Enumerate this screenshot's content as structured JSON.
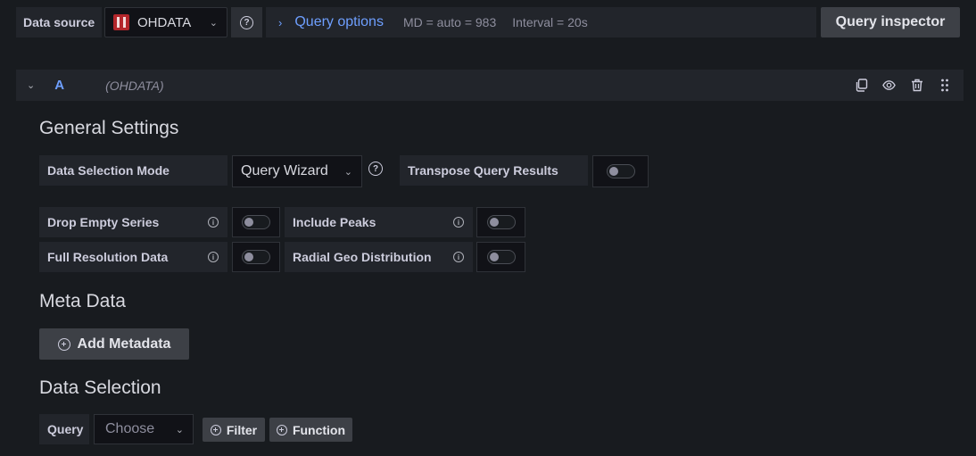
{
  "top_bar": {
    "data_source_label": "Data source",
    "data_source_value": "OHDATA",
    "query_options_title": "Query options",
    "md_text": "MD = auto = 983",
    "interval_text": "Interval = 20s",
    "query_inspector_label": "Query inspector"
  },
  "query_row": {
    "ref_id": "A",
    "datasource_name": "(OHDATA)",
    "actions": [
      "copy-icon",
      "eye-icon",
      "trash-icon",
      "drag-handle-icon"
    ]
  },
  "general_settings": {
    "heading": "General Settings",
    "data_selection_mode_label": "Data Selection Mode",
    "data_selection_mode_value": "Query Wizard",
    "transpose_label": "Transpose Query Results",
    "transpose_on": false,
    "options": [
      {
        "label": "Drop Empty Series",
        "on": false
      },
      {
        "label": "Include Peaks",
        "on": false
      },
      {
        "label": "Full Resolution Data",
        "on": false
      },
      {
        "label": "Radial Geo Distribution",
        "on": false
      }
    ]
  },
  "meta_data": {
    "heading": "Meta Data",
    "add_button_label": "Add Metadata"
  },
  "data_selection": {
    "heading": "Data Selection",
    "query_label": "Query",
    "query_placeholder": "Choose",
    "filter_label": "Filter",
    "function_label": "Function"
  },
  "colors": {
    "accent": "#6e9fff",
    "background": "#181b1f",
    "panel": "#22252b",
    "button": "#3d4046"
  }
}
